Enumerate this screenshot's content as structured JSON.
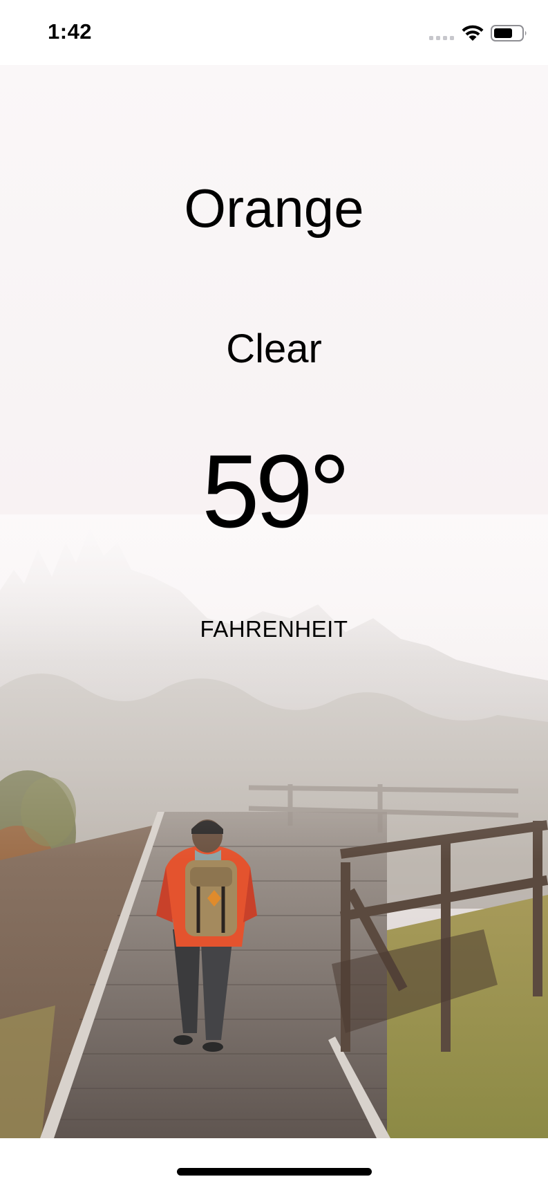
{
  "status_bar": {
    "time": "1:42",
    "icons": [
      "cellular-signal-icon",
      "wifi-icon",
      "battery-icon"
    ]
  },
  "weather": {
    "city": "Orange",
    "condition": "Clear",
    "temperature": "59°",
    "unit_label": "FAHRENHEIT"
  },
  "background": {
    "subject": "hiker-on-foggy-boardwalk",
    "jacket_color": "#e4532e"
  }
}
